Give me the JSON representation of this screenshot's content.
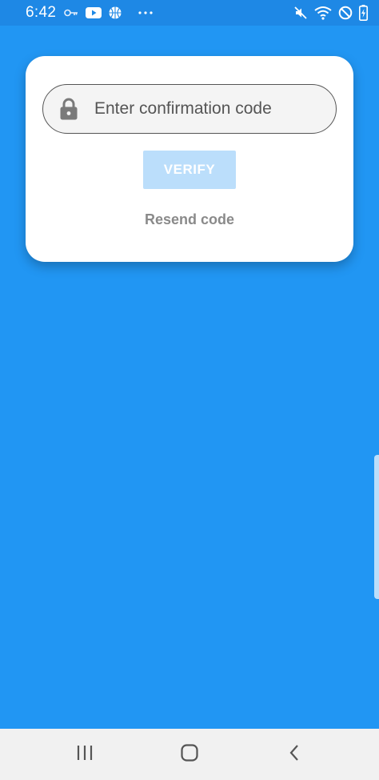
{
  "status_bar": {
    "time": "6:42",
    "left_icons": [
      "key-icon",
      "youtube-icon",
      "basketball-icon",
      "more-dots-icon"
    ],
    "right_icons": [
      "mute-icon",
      "wifi-icon",
      "do-not-disturb-icon",
      "battery-charging-icon"
    ]
  },
  "card": {
    "code_field": {
      "icon": "lock-icon",
      "placeholder": "Enter confirmation code",
      "value": ""
    },
    "verify_label": "VERIFY",
    "resend_label": "Resend code"
  },
  "nav_bar": {
    "buttons": [
      "recent-apps-icon",
      "home-icon",
      "back-icon"
    ]
  },
  "colors": {
    "background": "#2196F3",
    "status_bar": "#1E88E5",
    "verify_disabled": "#BBDEFB",
    "resend_text": "#8a8a8a"
  }
}
